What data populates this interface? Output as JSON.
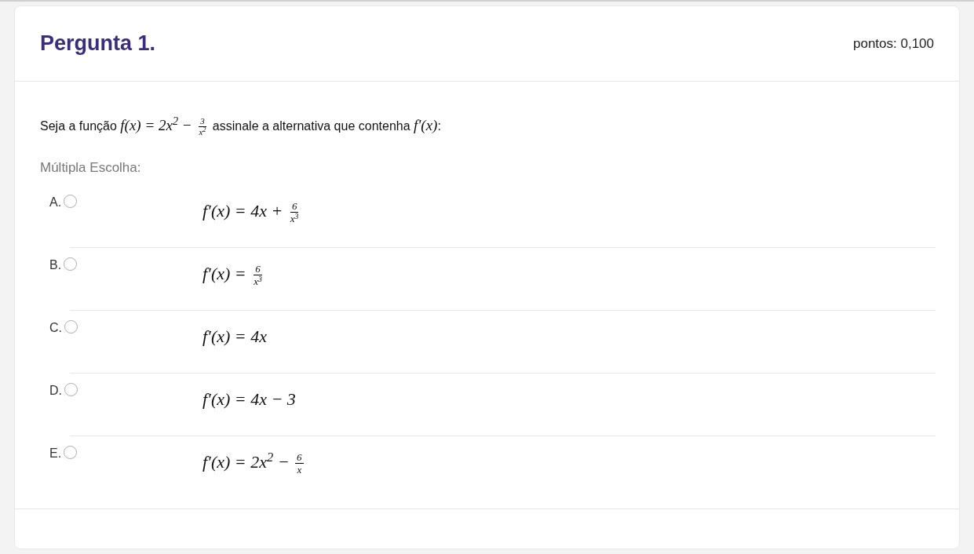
{
  "question": {
    "title": "Pergunta 1.",
    "points": "pontos: 0,100",
    "statement": [
      {
        "kind": "text",
        "text": "Seja a função "
      },
      {
        "kind": "math",
        "parts": [
          {
            "kind": "text",
            "text": "f(x) = 2x$^{2}$ − "
          },
          {
            "kind": "frac",
            "num": "3",
            "den": "x$^{2}$"
          }
        ]
      },
      {
        "kind": "text",
        "text": " assinale a alternativa que contenha "
      },
      {
        "kind": "math",
        "parts": [
          {
            "kind": "text",
            "text": "f'(x)"
          }
        ]
      },
      {
        "kind": "text",
        "text": ":"
      }
    ],
    "choice_label": "Múltipla Escolha:",
    "options": [
      {
        "letter": "A.",
        "selected": false,
        "formula": [
          {
            "kind": "text",
            "text": "f′(x) = 4x + "
          },
          {
            "kind": "frac",
            "num": "6",
            "den": "x$^{3}$"
          }
        ]
      },
      {
        "letter": "B.",
        "selected": false,
        "formula": [
          {
            "kind": "text",
            "text": "f′(x) = "
          },
          {
            "kind": "frac",
            "num": "6",
            "den": "x$^{3}$"
          }
        ]
      },
      {
        "letter": "C.",
        "selected": false,
        "formula": [
          {
            "kind": "text",
            "text": "f′(x) = 4x"
          }
        ]
      },
      {
        "letter": "D.",
        "selected": false,
        "formula": [
          {
            "kind": "text",
            "text": "f′(x) = 4x − 3"
          }
        ]
      },
      {
        "letter": "E.",
        "selected": false,
        "formula": [
          {
            "kind": "text",
            "text": "f′(x) = 2x$^{2}$ − "
          },
          {
            "kind": "frac",
            "num": "6",
            "den": "x"
          }
        ]
      }
    ]
  }
}
